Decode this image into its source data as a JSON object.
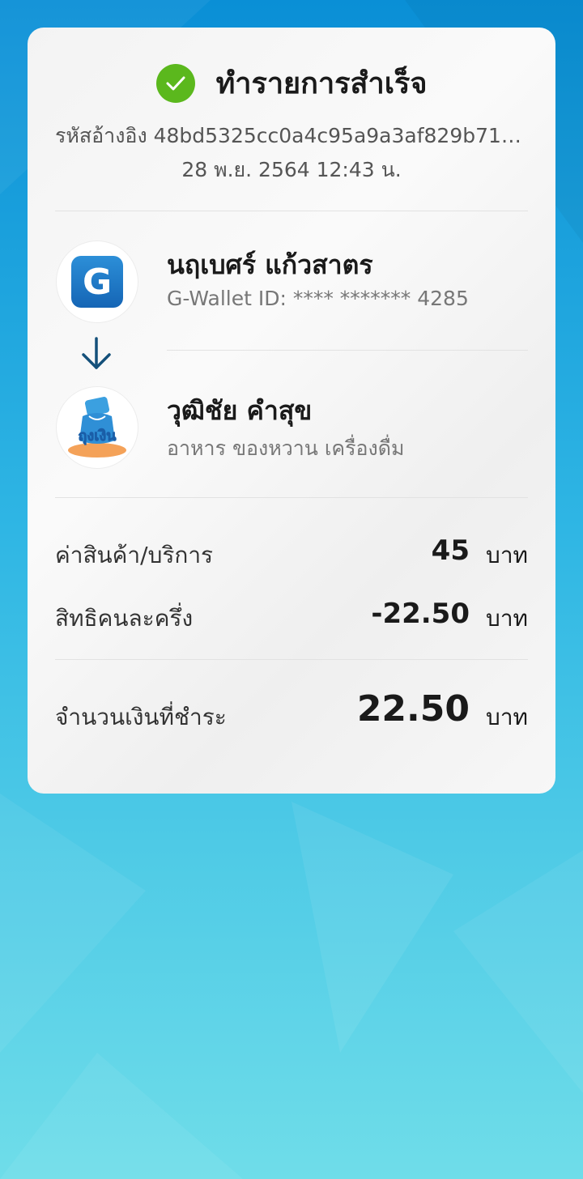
{
  "status": {
    "title": "ทำรายการสำเร็จ",
    "icon": "check-circle-icon",
    "icon_color": "#5bb81d"
  },
  "reference": {
    "text": "รหัสอ้างอิง 48bd5325cc0a4c95a9a3af829b719..."
  },
  "datetime": "28 พ.ย. 2564 12:43 น.",
  "sender": {
    "name": "นฤเบศร์ แก้วสาตร",
    "sub": "G-Wallet ID: **** ******* 4285",
    "logo_letter": "G",
    "logo_color": "#1b74c5"
  },
  "transfer_arrow": "arrow-down-icon",
  "receiver": {
    "name": "วุฒิชัย คำสุข",
    "sub": "อาหาร ของหวาน เครื่องดื่ม",
    "logo_text": "ถุงเงิน"
  },
  "lines": [
    {
      "label": "ค่าสินค้า/บริการ",
      "amount": "45",
      "unit": "บาท"
    },
    {
      "label": "สิทธิคนละครึ่ง",
      "amount": "-22.50",
      "unit": "บาท"
    }
  ],
  "total": {
    "label": "จำนวนเงินที่ชำระ",
    "amount": "22.50",
    "unit": "บาท"
  }
}
